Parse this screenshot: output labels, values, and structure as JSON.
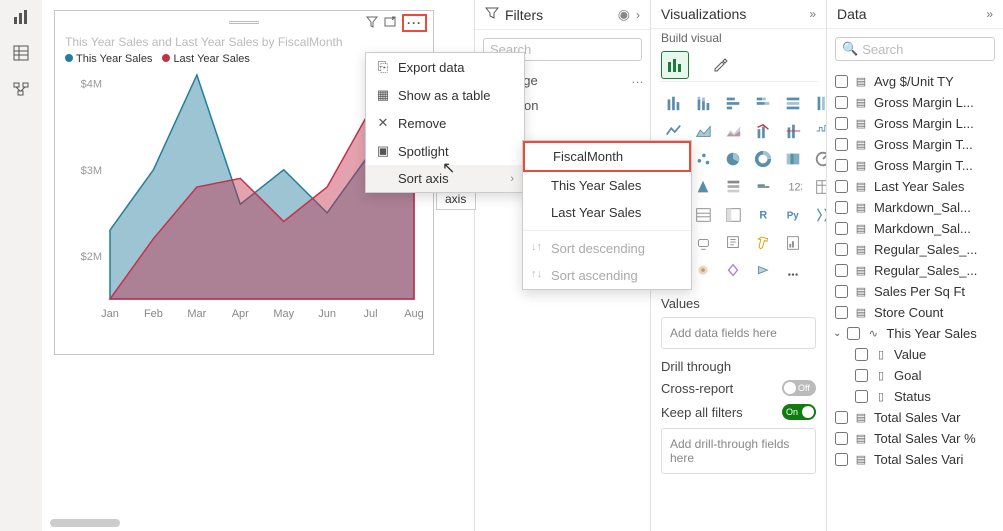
{
  "leftRail": {
    "reportTip": "Report",
    "tableTip": "Data",
    "modelTip": "Model"
  },
  "chart_data": {
    "type": "area",
    "title": "This Year Sales and Last Year Sales by FiscalMonth",
    "categories": [
      "Jan",
      "Feb",
      "Mar",
      "Apr",
      "May",
      "Jun",
      "Jul",
      "Aug"
    ],
    "series": [
      {
        "name": "This Year Sales",
        "color": "#237d9c",
        "values": [
          2300000,
          3000000,
          4100000,
          2600000,
          3000000,
          2500000,
          3200000,
          3400000
        ]
      },
      {
        "name": "Last Year Sales",
        "color": "#c4314b",
        "values": [
          1500000,
          2200000,
          2800000,
          2900000,
          2400000,
          2800000,
          3700000,
          3200000
        ]
      }
    ],
    "ylim": [
      1500000,
      4100000
    ],
    "yticks": [
      2000000,
      3000000,
      4000000
    ],
    "ytick_labels": [
      "$2M",
      "$3M",
      "$4M"
    ]
  },
  "contextMenu": {
    "exportData": "Export data",
    "showTable": "Show as a table",
    "remove": "Remove",
    "spotlight": "Spotlight",
    "sortAxis": "Sort axis"
  },
  "tooltip": "Sort axis",
  "sortSubmenu": {
    "fiscalMonth": "FiscalMonth",
    "thisYear": "This Year Sales",
    "lastYear": "Last Year Sales",
    "desc": "Sort descending",
    "asc": "Sort ascending"
  },
  "filters": {
    "title": "Filters",
    "searchPlaceholder": "Search",
    "thisPage": "this page",
    "filtersOn": "Filters on",
    "addVisual": "A"
  },
  "viz": {
    "title": "Visualizations",
    "build": "Build visual",
    "valuesLabel": "Values",
    "valuesWell": "Add data fields here",
    "drillLabel": "Drill through",
    "crossReport": "Cross-report",
    "keepFilters": "Keep all filters",
    "drillWell": "Add drill-through fields here",
    "off": "Off",
    "on": "On"
  },
  "data": {
    "title": "Data",
    "searchPlaceholder": "Search",
    "fields": [
      {
        "label": "Avg $/Unit TY",
        "type": "measure"
      },
      {
        "label": "Gross Margin L...",
        "type": "measure"
      },
      {
        "label": "Gross Margin L...",
        "type": "measure"
      },
      {
        "label": "Gross Margin T...",
        "type": "measure"
      },
      {
        "label": "Gross Margin T...",
        "type": "measure"
      },
      {
        "label": "Last Year Sales",
        "type": "measure"
      },
      {
        "label": "Markdown_Sal...",
        "type": "measure"
      },
      {
        "label": "Markdown_Sal...",
        "type": "measure"
      },
      {
        "label": "Regular_Sales_...",
        "type": "measure"
      },
      {
        "label": "Regular_Sales_...",
        "type": "measure"
      },
      {
        "label": "Sales Per Sq Ft",
        "type": "measure"
      },
      {
        "label": "Store Count",
        "type": "measure"
      }
    ],
    "hierName": "This Year Sales",
    "hierChildren": [
      {
        "label": "Value"
      },
      {
        "label": "Goal"
      },
      {
        "label": "Status"
      }
    ],
    "tail": [
      {
        "label": "Total Sales Var",
        "type": "measure"
      },
      {
        "label": "Total Sales Var %",
        "type": "measure"
      },
      {
        "label": "Total Sales Vari",
        "type": "measure"
      }
    ]
  }
}
